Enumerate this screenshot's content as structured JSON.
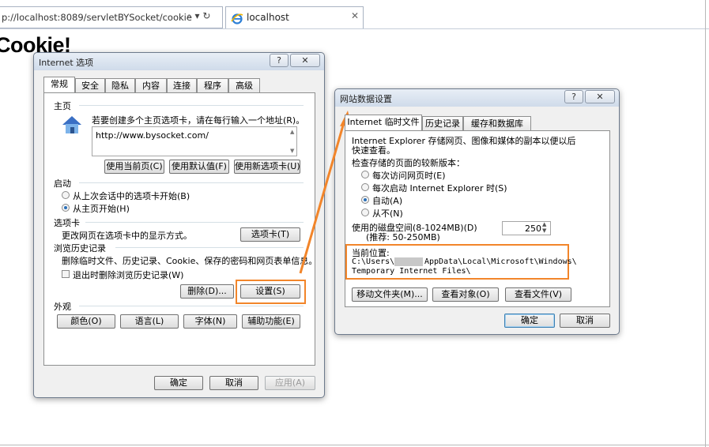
{
  "browser": {
    "url": "p://localhost:8089/servletBYSocket/cookie",
    "addr_tools": "⌕ ▾ ↻",
    "tab_title": "localhost",
    "tab_close": "✕",
    "page_heading": "Cookie!"
  },
  "internet_options": {
    "title": "Internet 选项",
    "help": "?",
    "close": "✕",
    "tabs": [
      "常规",
      "安全",
      "隐私",
      "内容",
      "连接",
      "程序",
      "高级"
    ],
    "home": {
      "heading": "主页",
      "desc": "若要创建多个主页选项卡，请在每行输入一个地址(R)。",
      "value": "http://www.bysocket.com/",
      "btn_current": "使用当前页(C)",
      "btn_default": "使用默认值(F)",
      "btn_new_tab": "使用新选项卡(U)"
    },
    "startup": {
      "heading": "启动",
      "opt_last": "从上次会话中的选项卡开始(B)",
      "opt_home": "从主页开始(H)"
    },
    "tabs_group": {
      "heading": "选项卡",
      "desc": "更改网页在选项卡中的显示方式。",
      "button": "选项卡(T)"
    },
    "history": {
      "heading": "浏览历史记录",
      "desc": "删除临时文件、历史记录、Cookie、保存的密码和网页表单信息。",
      "checkbox": "退出时删除浏览历史记录(W)",
      "btn_delete": "删除(D)...",
      "btn_settings": "设置(S)"
    },
    "appearance": {
      "heading": "外观",
      "btn_colors": "颜色(O)",
      "btn_languages": "语言(L)",
      "btn_fonts": "字体(N)",
      "btn_accessibility": "辅助功能(E)"
    },
    "ok": "确定",
    "cancel": "取消",
    "apply": "应用(A)"
  },
  "site_data": {
    "title": "网站数据设置",
    "help": "?",
    "close": "✕",
    "tabs": [
      "Internet 临时文件",
      "历史记录",
      "缓存和数据库"
    ],
    "desc_line1": "Internet Explorer 存储网页、图像和媒体的副本以便以后",
    "desc_line2": "快速查看。",
    "check_label": "检查存储的页面的较新版本：",
    "opt_every_visit": "每次访问网页时(E)",
    "opt_every_start": "每次启动 Internet Explorer 时(S)",
    "opt_auto": "自动(A)",
    "opt_never": "从不(N)",
    "disk_label": "使用的磁盘空间(8-1024MB)(D)",
    "disk_hint": "(推荐: 50-250MB)",
    "disk_value": "250",
    "location_label": "当前位置:",
    "location_line1a": "C:\\Users\\",
    "location_line1b": "AppData\\Local\\Microsoft\\Windows\\",
    "location_line2": "Temporary Internet Files\\",
    "btn_move": "移动文件夹(M)...",
    "btn_view_objects": "查看对象(O)",
    "btn_view_files": "查看文件(V)",
    "ok": "确定",
    "cancel": "取消"
  },
  "colors": {
    "highlight": "#f2852a"
  }
}
